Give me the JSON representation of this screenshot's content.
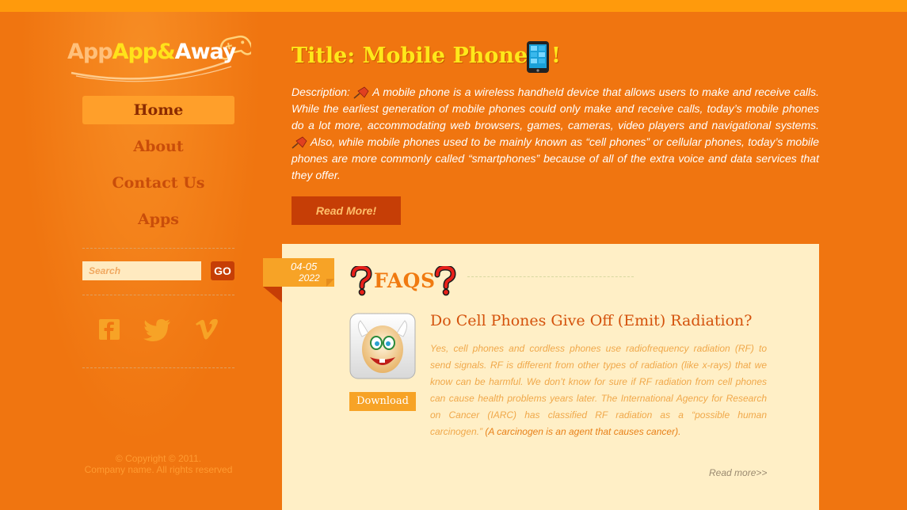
{
  "logo": {
    "part1": "App",
    "part2": "App&",
    "part3": "Away"
  },
  "nav": [
    {
      "label": "Home",
      "active": true
    },
    {
      "label": "About",
      "active": false
    },
    {
      "label": "Contact Us",
      "active": false
    },
    {
      "label": "Apps",
      "active": false
    }
  ],
  "search": {
    "placeholder": "Search",
    "go_label": "GO"
  },
  "social": [
    "facebook-icon",
    "twitter-icon",
    "vimeo-icon"
  ],
  "footer": {
    "copyright": "© Copyright © 2011.",
    "rights": "Company name. All rights reserved"
  },
  "main": {
    "title": "Title: Mobile Phone",
    "title_suffix": "!",
    "description_label": "Description:",
    "description_p1": " A mobile phone is a wireless handheld device that allows users to make and receive calls. While the earliest generation of mobile phones could only make and receive calls, today’s mobile phones do a lot more, accommodating web browsers, games, cameras, video players and navigational systems.",
    "description_p2": " Also, while mobile phones used to be mainly known as “cell phones” or cellular phones, today’s mobile phones are more commonly called “smartphones” because of all of the extra voice and data services that they offer.",
    "readmore_label": "Read More!"
  },
  "faq": {
    "date_line1": "04-05",
    "date_line2": "2022",
    "section_title": "FAQS",
    "question": "Do Cell Phones Give Off (Emit) Radiation?",
    "answer": "Yes, cell phones and cordless phones use radiofrequency radiation (RF) to send signals. RF is different from other types of radiation (like x-rays) that we know can be harmful. We don’t know for sure if RF radiation from cell phones can cause health problems years later. The International Agency for Research on Cancer (IARC) has classified RF radiation as a “possible human carcinogen.”",
    "answer_tail": " (A carcinogen is an agent that causes cancer).",
    "download_label": "Download",
    "readmore_label": "Read more>>"
  },
  "colors": {
    "background": "#f07510",
    "accent": "#c63e06",
    "panel": "#ffefc6",
    "title": "#ffe81a"
  }
}
